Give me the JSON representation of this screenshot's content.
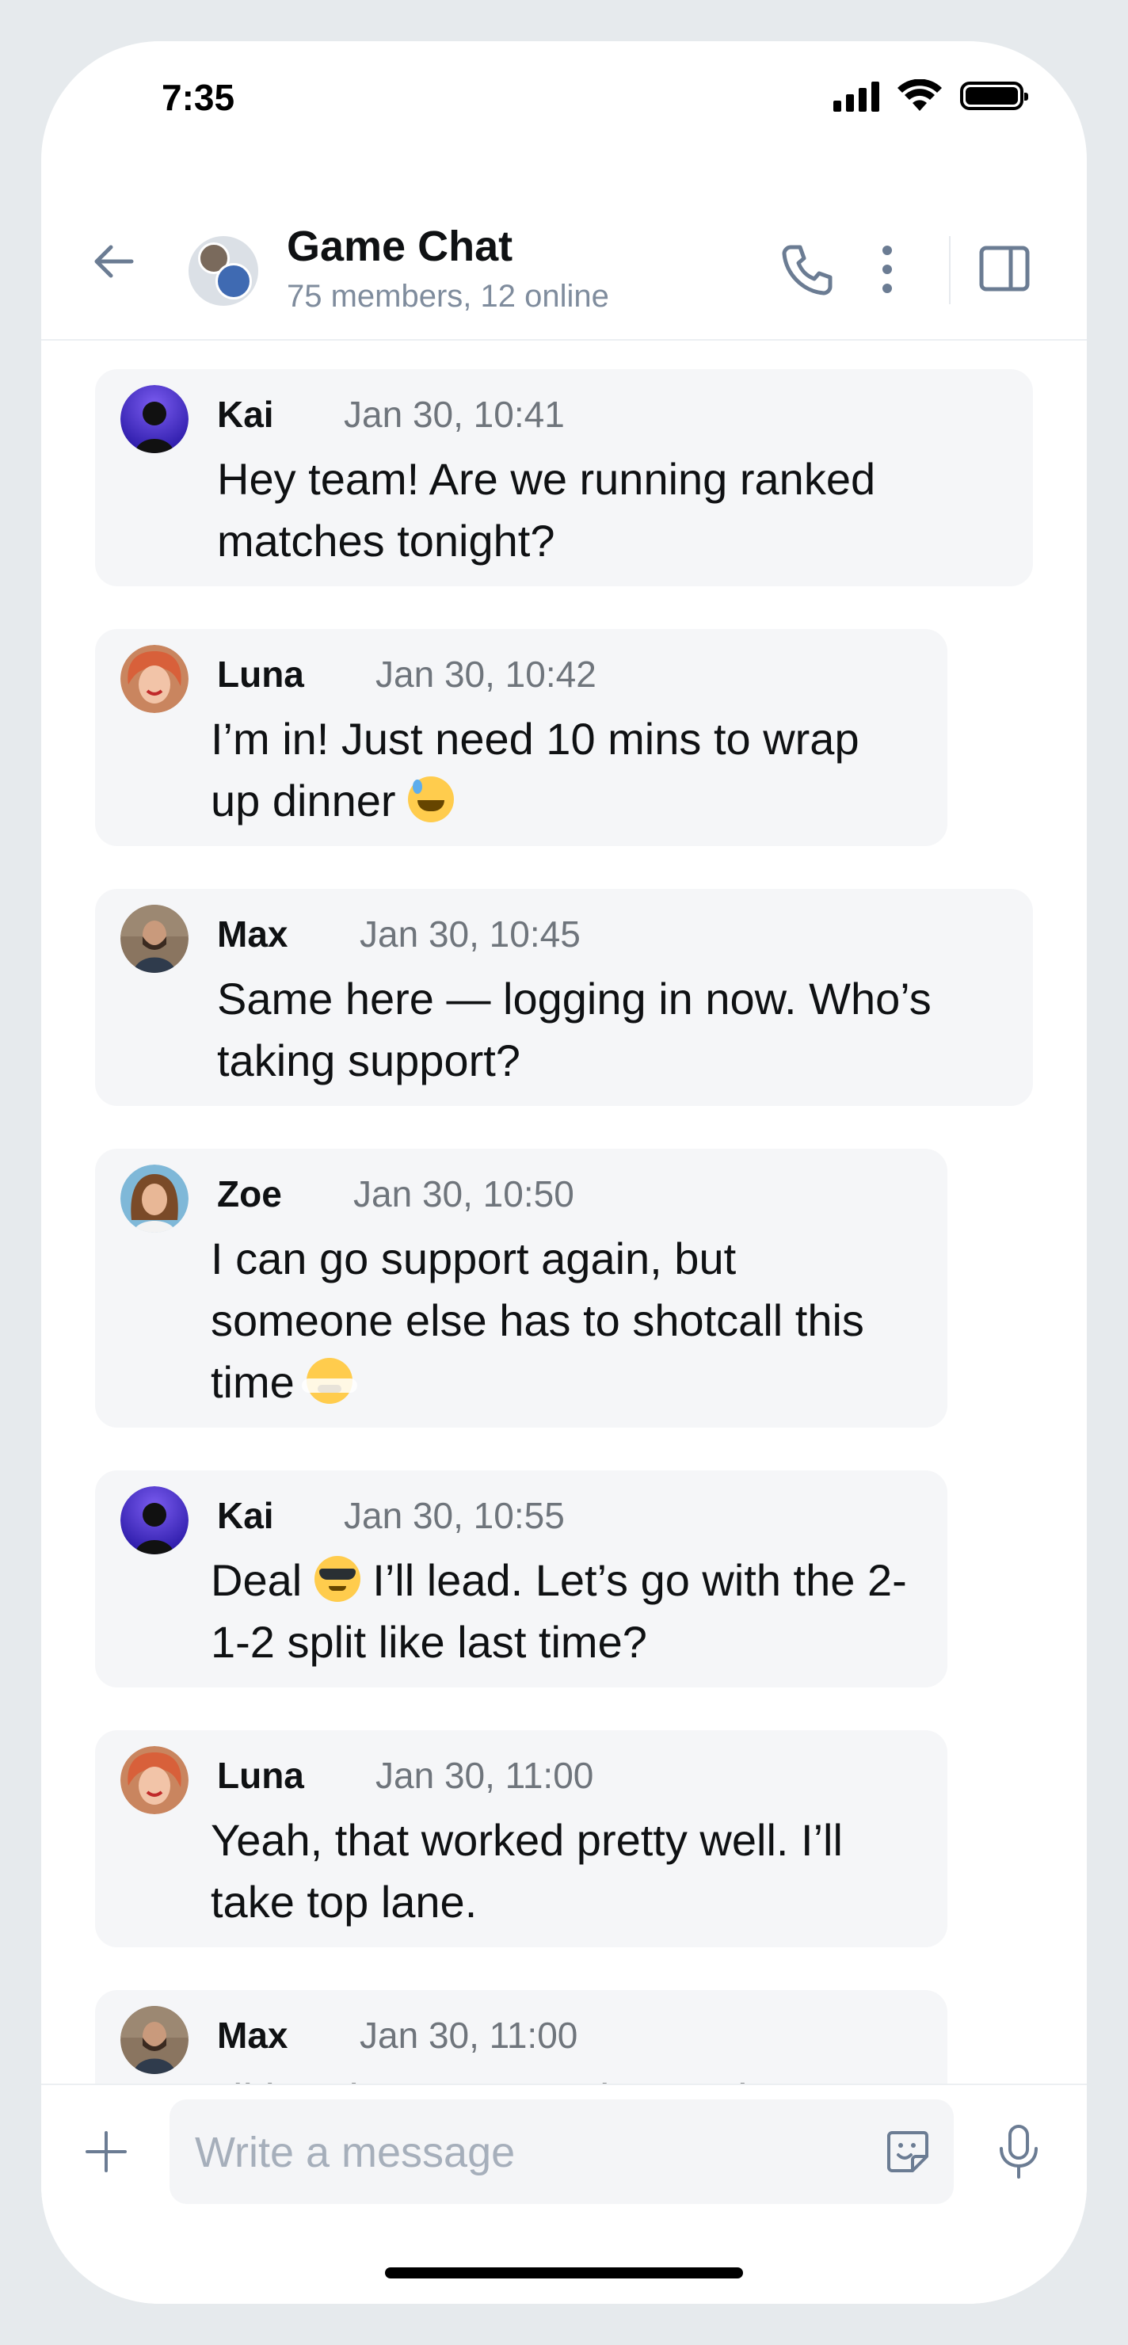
{
  "status_bar": {
    "time": "7:35"
  },
  "header": {
    "title": "Game Chat",
    "subtitle": "75 members, 12 online"
  },
  "messages": [
    {
      "author": "Kai",
      "time": "Jan 30, 10:41",
      "text": "Hey team! Are we running ranked matches tonight?",
      "avatar": "kai-avatar"
    },
    {
      "author": "Luna",
      "time": "Jan 30, 10:42",
      "text": "I’m in! Just need 10 mins to wrap up dinner",
      "emoji": "grinning-sweat-emoji",
      "avatar": "luna-avatar"
    },
    {
      "author": "Max",
      "time": "Jan 30, 10:45",
      "text": "Same here — logging in now. Who’s taking support?",
      "avatar": "max-avatar"
    },
    {
      "author": "Zoe",
      "time": "Jan 30, 10:50",
      "text": "I can go support again, but someone else has to shotcall this time",
      "emoji": "steam-face-emoji",
      "avatar": "zoe-avatar"
    },
    {
      "author": "Kai",
      "time": "Jan 30, 10:55",
      "text_before": "Deal",
      "text_after": " I’ll lead. Let’s go with the 2-1-2 split like last time?",
      "emoji": "sunglasses-emoji",
      "avatar": "kai-avatar"
    },
    {
      "author": "Luna",
      "time": "Jan 30, 11:00",
      "text": "Yeah, that worked pretty well. I’ll take top lane.",
      "avatar": "luna-avatar"
    },
    {
      "author": "Max",
      "time": "Jan 30, 11:00",
      "text": "I’ll jungle. Let’s get that early",
      "avatar": "max-avatar"
    }
  ],
  "composer": {
    "placeholder": "Write a message"
  },
  "colors": {
    "bubble": "#f5f6f8",
    "subtitle": "#7f8c9d",
    "icon": "#6b7c93"
  }
}
